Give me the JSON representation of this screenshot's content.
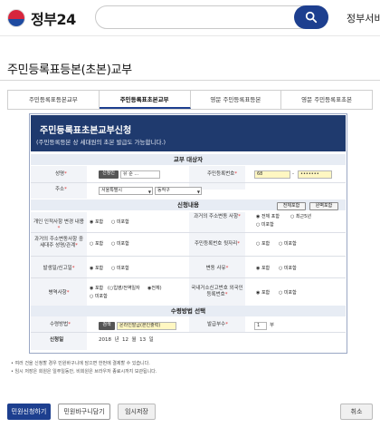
{
  "header": {
    "logo_text": "정부24",
    "search_placeholder": "",
    "right_link": "정부서비스"
  },
  "page": {
    "title": "주민등록표등본(초본)교부"
  },
  "tabs": [
    {
      "label": "주민등록표등본교부",
      "active": false
    },
    {
      "label": "주민등록표초본교부",
      "active": true
    },
    {
      "label": "영문 주민등록표등본",
      "active": false
    },
    {
      "label": "영문 주민등록표초본",
      "active": false
    }
  ],
  "form": {
    "title": "주민등록표초본교부신청",
    "subtitle": "(주민등록등본 상 세대원의 초본 발급도 가능합니다.)",
    "section_target": "교부 대상자",
    "name_label": "성명",
    "name_btn": "신청인",
    "name_value": "유 순 ...",
    "rrn_label": "주민등록번호",
    "rrn_front": "68",
    "rrn_back": "•••••••",
    "addr_label": "주소",
    "addr_city": "서울특별시",
    "addr_district": "동작구",
    "section_content": "신청내용",
    "btn_all_include": "전체포함",
    "btn_all_full": "완벽포함",
    "rows": {
      "personal_history": {
        "label": "개인 인적사항 변경 내용",
        "opt1": "포함",
        "opt2": "미포함"
      },
      "past_address": {
        "label": "과거의 주소변동 사항",
        "opt1": "전체 포함",
        "opt2": "최근5년",
        "opt3": "미포함"
      },
      "past_address_extra": {
        "label": "과거의 주소변동사항 중 세대주 성명/관계",
        "opt1": "포함",
        "opt2": "미포함"
      },
      "rrn_back_digits": {
        "label": "주민등록번호 뒷자리",
        "opt1": "포함",
        "opt2": "미포함"
      },
      "issue_date": {
        "label": "발생일/신고일",
        "opt1": "포함",
        "opt2": "미포함"
      },
      "change_reason": {
        "label": "변동 사유",
        "opt1": "포함",
        "opt2": "미포함"
      },
      "military": {
        "label": "병역사항",
        "opt1": "포함",
        "opt2": "입영/전역일자",
        "opt3": "전체",
        "opt4": "미포함"
      },
      "foreign": {
        "label": "국내거소신고번호 외국인등록번호",
        "opt1": "포함",
        "opt2": "미포함"
      }
    },
    "section_receipt": "수령방법 선택",
    "receipt_label": "수령방법",
    "receipt_search_btn": "검색",
    "receipt_value": "온라인발급(본인출력)",
    "copies_label": "발급부수",
    "copies_value": "1",
    "copies_unit": "부",
    "apply_date_label": "신청일",
    "apply_date_value": "2018  년  12  월  13  일"
  },
  "notes": [
    "• 여러 건을 신청할 경우 민원바구니에 담으면 한번에 결제할 수 있습니다.",
    "• 임시 저장은 회원은 일주일동안, 비회원은 브라우저 종료시까지 보관됩니다."
  ],
  "buttons": {
    "apply": "민원신청하기",
    "basket": "민원바구니담기",
    "temp_save": "임시저장",
    "cancel": "취소"
  },
  "colors": {
    "brand_navy": "#1d3f8f",
    "panel_header": "#1f3a6e",
    "required": "#d33333"
  }
}
